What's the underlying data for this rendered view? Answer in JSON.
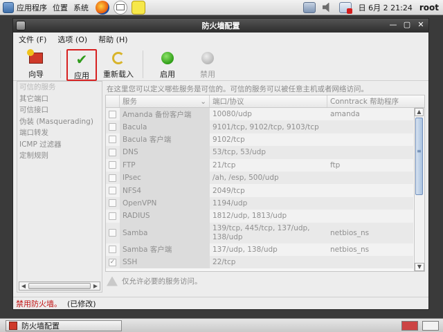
{
  "top_panel": {
    "apps": "应用程序",
    "places": "位置",
    "system": "系统",
    "clock": "日 6月  2 21:24",
    "user": "root"
  },
  "window": {
    "title": "防火墙配置",
    "menu": [
      "文件 (F)",
      "选项 (O)",
      "帮助 (H)"
    ],
    "toolbar": {
      "wizard": "向导",
      "apply": "应用",
      "reload": "重新载入",
      "enable": "启用",
      "disable": "禁用"
    },
    "nav": [
      "可信的服务",
      "其它端口",
      "可信接口",
      "伪装 (Masquerading)",
      "端口转发",
      "ICMP 过滤器",
      "定制规则"
    ],
    "description": "在这里您可以定义哪些服务是可信的。可信的服务可以被任意主机或者网络访问。",
    "columns": {
      "service": "服务",
      "port": "端口/协议",
      "conntrack": "Conntrack 帮助程序"
    },
    "rows": [
      {
        "service": "Amanda 备份客户端",
        "port": "10080/udp",
        "conntrack": "amanda",
        "checked": false
      },
      {
        "service": "Bacula",
        "port": "9101/tcp, 9102/tcp, 9103/tcp",
        "conntrack": "",
        "checked": false
      },
      {
        "service": "Bacula 客户端",
        "port": "9102/tcp",
        "conntrack": "",
        "checked": false
      },
      {
        "service": "DNS",
        "port": "53/tcp, 53/udp",
        "conntrack": "",
        "checked": false
      },
      {
        "service": "FTP",
        "port": "21/tcp",
        "conntrack": "ftp",
        "checked": false
      },
      {
        "service": "IPsec",
        "port": "/ah, /esp, 500/udp",
        "conntrack": "",
        "checked": false
      },
      {
        "service": "NFS4",
        "port": "2049/tcp",
        "conntrack": "",
        "checked": false
      },
      {
        "service": "OpenVPN",
        "port": "1194/udp",
        "conntrack": "",
        "checked": false
      },
      {
        "service": "RADIUS",
        "port": "1812/udp, 1813/udp",
        "conntrack": "",
        "checked": false
      },
      {
        "service": "Samba",
        "port": "139/tcp, 445/tcp, 137/udp, 138/udp",
        "conntrack": "netbios_ns",
        "checked": false
      },
      {
        "service": "Samba 客户端",
        "port": "137/udp, 138/udp",
        "conntrack": "netbios_ns",
        "checked": false
      },
      {
        "service": "SSH",
        "port": "22/tcp",
        "conntrack": "",
        "checked": true
      }
    ],
    "hint": "仅允许必要的服务访问。",
    "status_red": "禁用防火墙。",
    "status_modified": "(已修改)"
  },
  "bottom_panel": {
    "task": "防火墙配置"
  }
}
